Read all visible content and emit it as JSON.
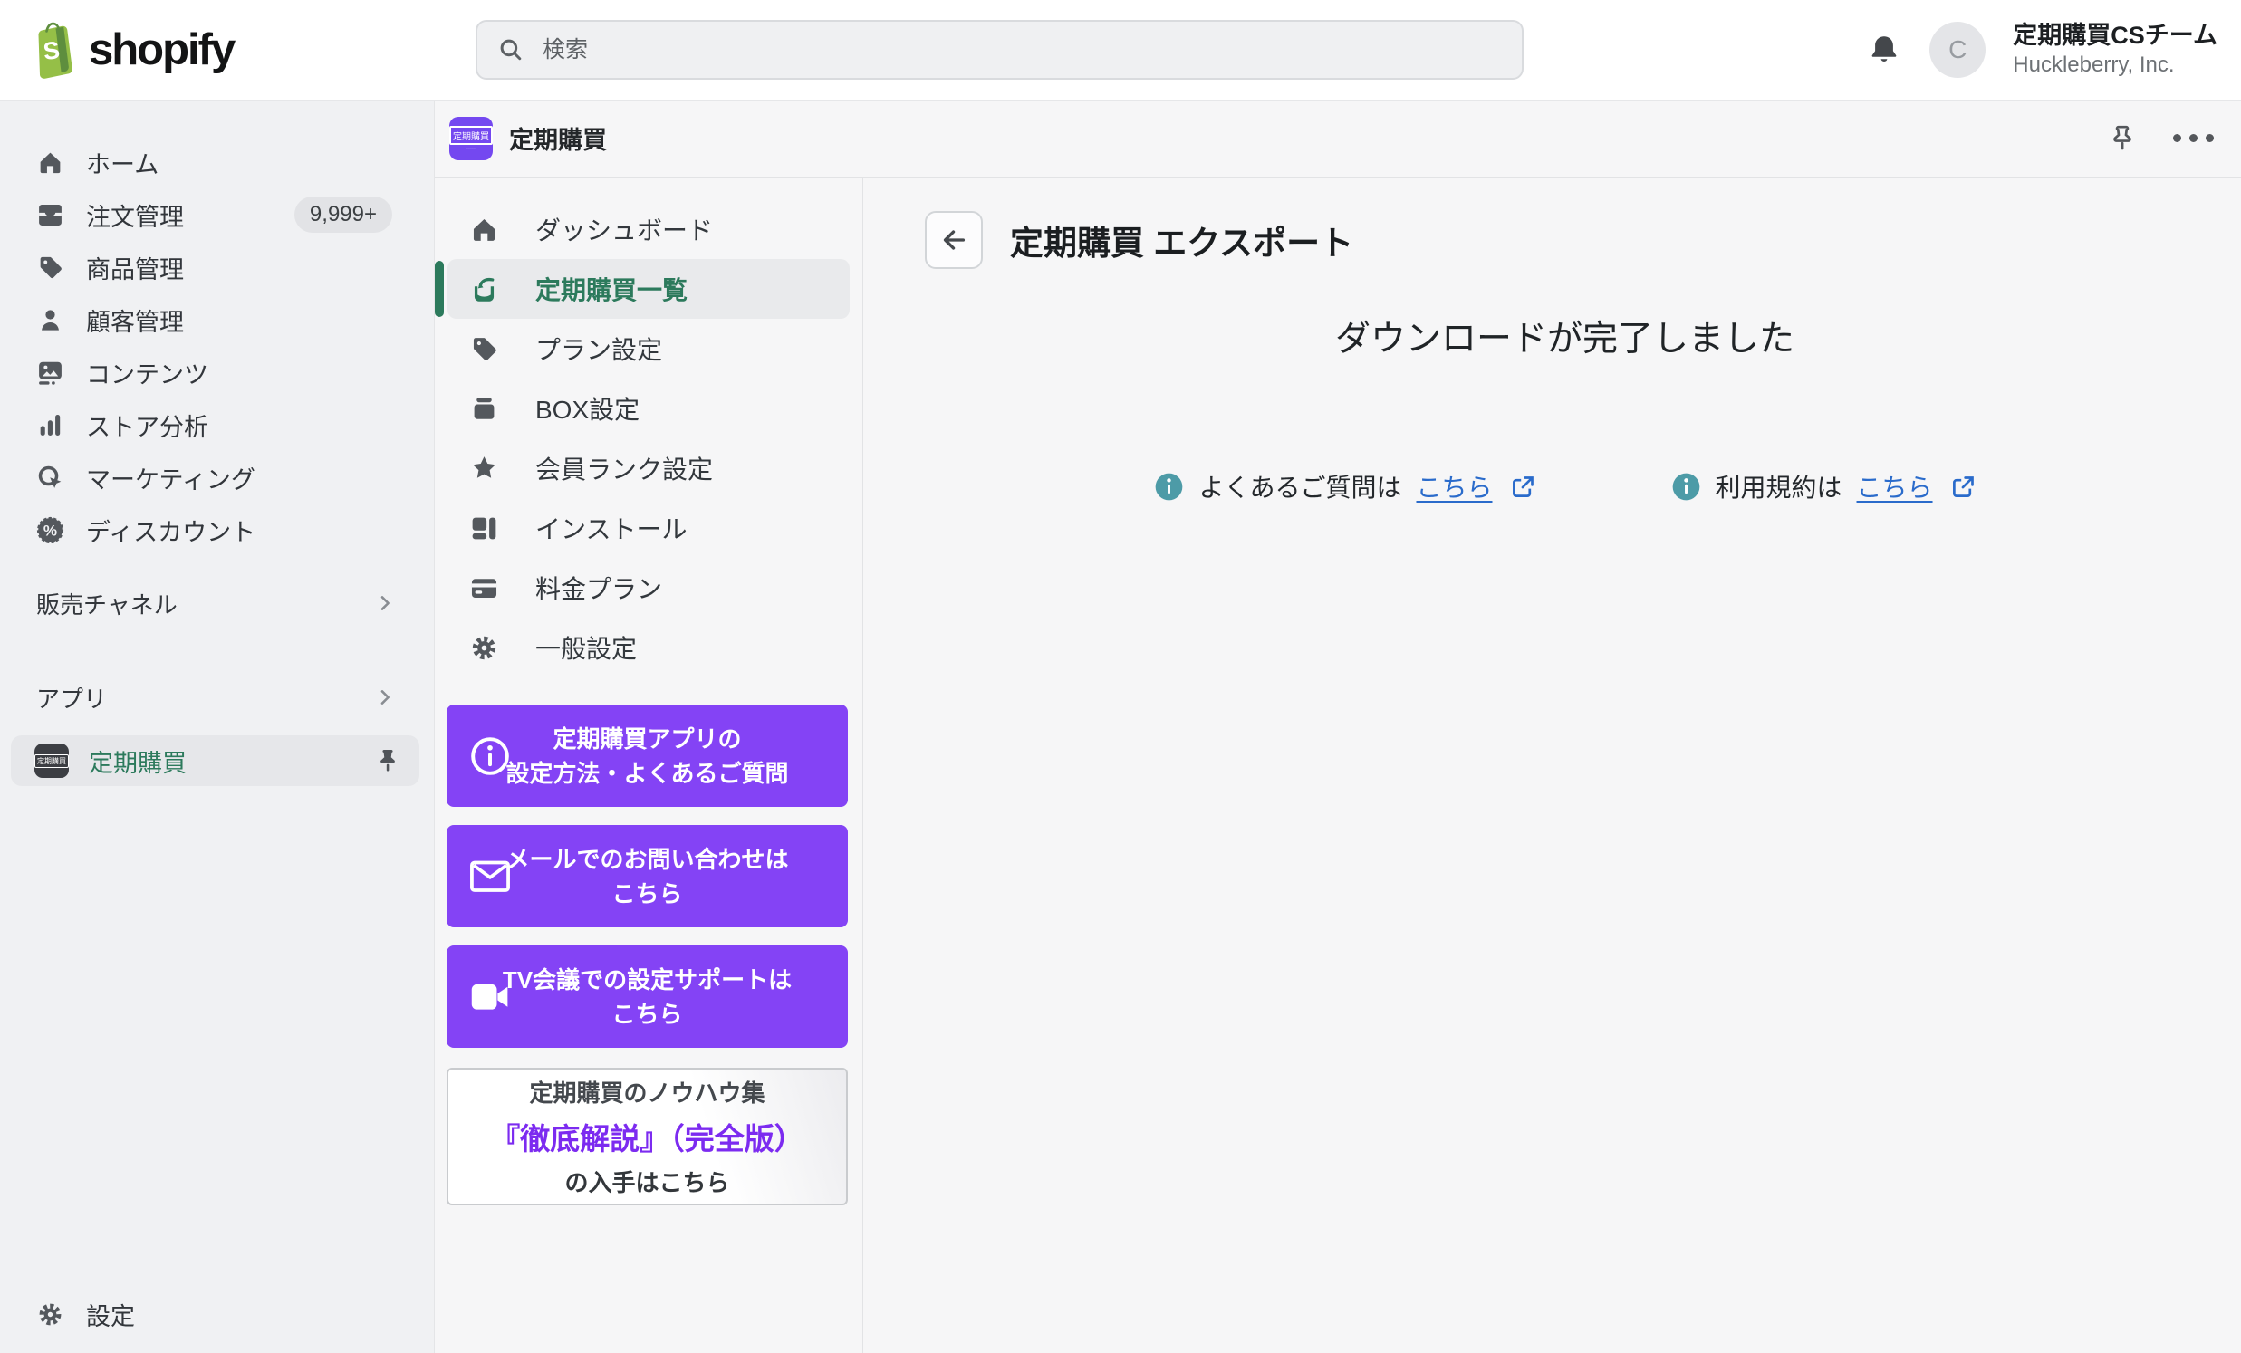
{
  "topbar": {
    "brand": "shopify",
    "search": {
      "placeholder": "検索"
    },
    "user": {
      "name": "定期購買CSチーム",
      "company": "Huckleberry, Inc.",
      "avatar_initial": "C"
    }
  },
  "sidebar": {
    "items": [
      {
        "label": "ホーム",
        "icon": "home-icon"
      },
      {
        "label": "注文管理",
        "icon": "orders-icon",
        "badge": "9,999+"
      },
      {
        "label": "商品管理",
        "icon": "products-icon"
      },
      {
        "label": "顧客管理",
        "icon": "customers-icon"
      },
      {
        "label": "コンテンツ",
        "icon": "content-icon"
      },
      {
        "label": "ストア分析",
        "icon": "analytics-icon"
      },
      {
        "label": "マーケティング",
        "icon": "marketing-icon"
      },
      {
        "label": "ディスカウント",
        "icon": "discount-icon"
      }
    ],
    "sections": [
      {
        "label": "販売チャネル"
      },
      {
        "label": "アプリ"
      }
    ],
    "pinned_app": {
      "label": "定期購買",
      "icon_text": "定期購買"
    },
    "footer": {
      "label": "設定",
      "icon": "gear-icon"
    }
  },
  "app": {
    "header": {
      "title": "定期購買",
      "icon_text": "定期購買"
    },
    "nav": [
      {
        "label": "ダッシュボード",
        "icon": "dashboard-icon"
      },
      {
        "label": "定期購買一覧",
        "icon": "subscription-list-icon",
        "selected": true
      },
      {
        "label": "プラン設定",
        "icon": "plan-settings-icon"
      },
      {
        "label": "BOX設定",
        "icon": "box-settings-icon"
      },
      {
        "label": "会員ランク設定",
        "icon": "member-rank-icon"
      },
      {
        "label": "インストール",
        "icon": "install-icon"
      },
      {
        "label": "料金プラン",
        "icon": "billing-plan-icon"
      },
      {
        "label": "一般設定",
        "icon": "general-settings-icon"
      }
    ],
    "promo_buttons": [
      {
        "icon": "info-icon",
        "line1": "定期購買アプリの",
        "line2": "設定方法・よくあるご質問"
      },
      {
        "icon": "mail-icon",
        "line1": "メールでのお問い合わせは",
        "line2": "こちら"
      },
      {
        "icon": "video-icon",
        "line1": "TV会議での設定サポートは",
        "line2": "こちら"
      }
    ],
    "knowhow_card": {
      "line1": "定期購買のノウハウ集",
      "line2": "『徹底解説』（完全版）",
      "line3": "の入手はこちら"
    }
  },
  "main": {
    "page_title": "定期購買 エクスポート",
    "message": "ダウンロードが完了しました",
    "links": [
      {
        "prefix": "よくあるご質問は",
        "link_text": "こちら"
      },
      {
        "prefix": "利用規約は",
        "link_text": "こちら"
      }
    ]
  },
  "colors": {
    "brand_green": "#95bf47",
    "nav_selected_green": "#2c7a5c",
    "promo_purple": "#8443f5",
    "knowhow_purple": "#7c2bf0",
    "app_icon_purple": "#7448f0",
    "link_blue": "#2a6bcb",
    "info_teal": "#4d9ba7"
  }
}
